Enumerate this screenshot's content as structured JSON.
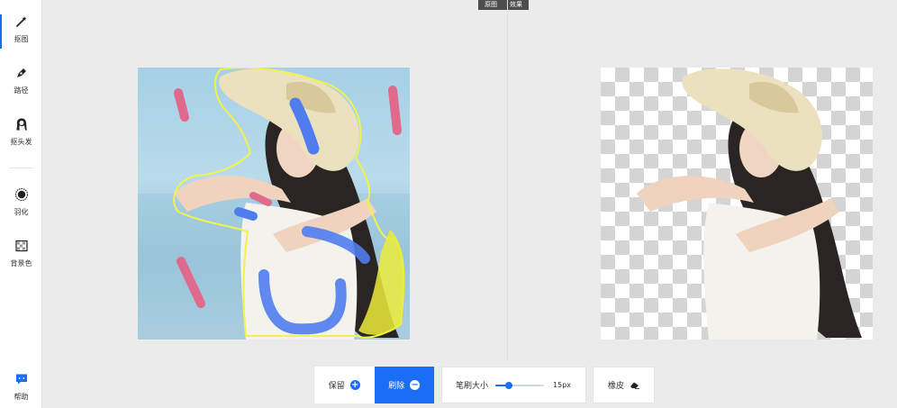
{
  "sidebar": {
    "items": [
      {
        "label": "抠图",
        "icon": "magic-wand-icon",
        "active": true
      },
      {
        "label": "路径",
        "icon": "pen-icon",
        "active": false
      },
      {
        "label": "抠头发",
        "icon": "hair-icon",
        "active": false
      },
      {
        "label": "羽化",
        "icon": "feather-circle-icon",
        "active": false
      },
      {
        "label": "背景色",
        "icon": "background-color-icon",
        "active": false
      }
    ],
    "help": {
      "label": "帮助",
      "icon": "help-chat-icon"
    }
  },
  "view_toggle": {
    "original": "原图",
    "effect": "效果"
  },
  "toolbar": {
    "keep_label": "保留",
    "erase_label": "刷除",
    "brush_size_label": "笔刷大小",
    "brush_size_value": "15px",
    "brush_size_level": 0.28,
    "eraser_label": "橡皮"
  },
  "colors": {
    "accent": "#1a6ef5",
    "keep_stroke": "#4f7df0",
    "erase_stroke": "#e06a8c",
    "selection_outline": "#f2f24a"
  }
}
